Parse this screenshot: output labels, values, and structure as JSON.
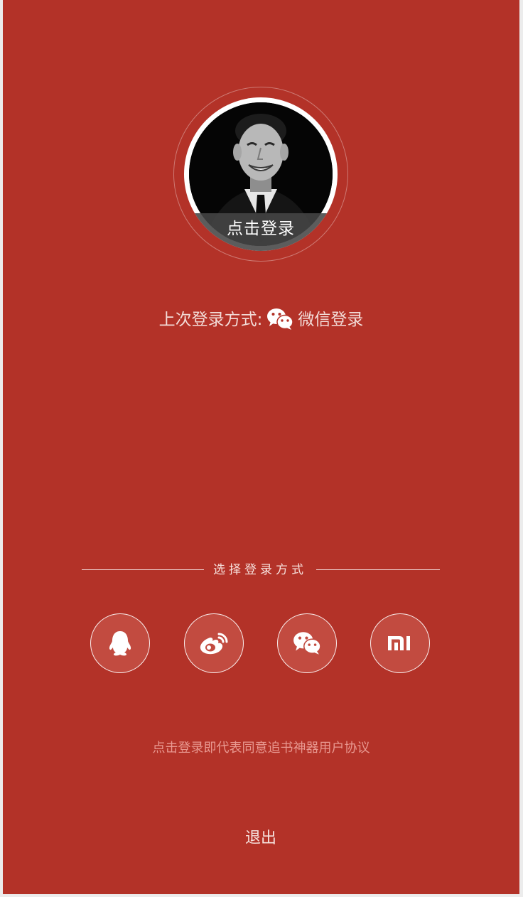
{
  "avatar": {
    "caption": "点击登录"
  },
  "last_login": {
    "label": "上次登录方式:",
    "method": "微信登录",
    "method_icon": "wechat-icon"
  },
  "login_section": {
    "title": "选择登录方式",
    "options": [
      {
        "name": "QQ",
        "icon": "qq-icon"
      },
      {
        "name": "Weibo",
        "icon": "weibo-icon"
      },
      {
        "name": "WeChat",
        "icon": "wechat-icon"
      },
      {
        "name": "Xiaomi",
        "icon": "mi-icon"
      }
    ]
  },
  "agreement": {
    "text": "点击登录即代表同意追书神器用户协议"
  },
  "exit": {
    "label": "退出"
  },
  "colors": {
    "background": "#b33228",
    "button_fill": "#c24b40",
    "agreement_text": "#e89890"
  }
}
